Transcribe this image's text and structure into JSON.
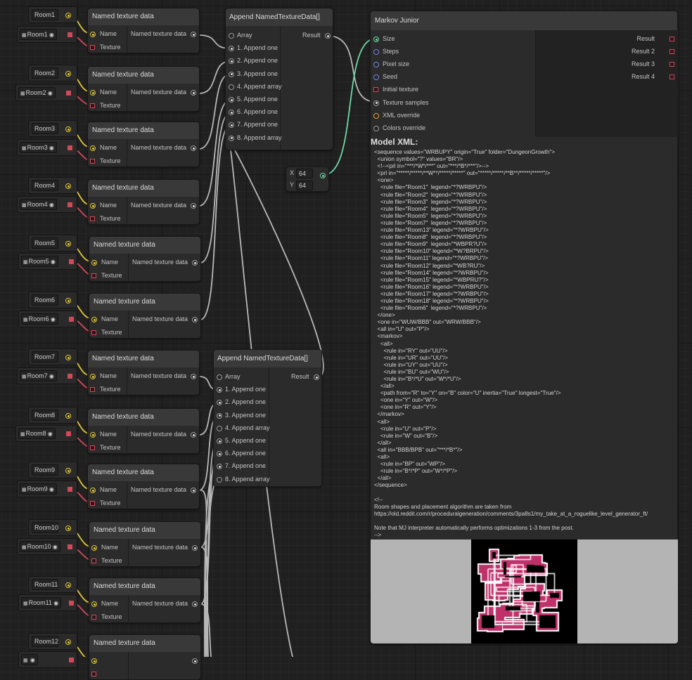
{
  "room_nodes": [
    {
      "name": "Room1",
      "texture": "Room1",
      "node_title": "Named texture data",
      "in_name": "Name",
      "in_texture": "Texture",
      "out_label": "Named texture data"
    },
    {
      "name": "Room2",
      "texture": "Room2",
      "node_title": "Named texture data",
      "in_name": "Name",
      "in_texture": "Texture",
      "out_label": "Named texture data"
    },
    {
      "name": "Room3",
      "texture": "Room3",
      "node_title": "Named texture data",
      "in_name": "Name",
      "in_texture": "Texture",
      "out_label": "Named texture data"
    },
    {
      "name": "Room4",
      "texture": "Room4",
      "node_title": "Named texture data",
      "in_name": "Name",
      "in_texture": "Texture",
      "out_label": "Named texture data"
    },
    {
      "name": "Room5",
      "texture": "Room5",
      "node_title": "Named texture data",
      "in_name": "Name",
      "in_texture": "Texture",
      "out_label": "Named texture data"
    },
    {
      "name": "Room6",
      "texture": "Room6",
      "node_title": "Named texture data",
      "in_name": "Name",
      "in_texture": "Texture",
      "out_label": "Named texture data"
    },
    {
      "name": "Room7",
      "texture": "Room7",
      "node_title": "Named texture data",
      "in_name": "Name",
      "in_texture": "Texture",
      "out_label": "Named texture data"
    },
    {
      "name": "Room8",
      "texture": "Room8",
      "node_title": "Named texture data",
      "in_name": "Name",
      "in_texture": "Texture",
      "out_label": "Named texture data"
    },
    {
      "name": "Room9",
      "texture": "Room9",
      "node_title": "Named texture data",
      "in_name": "Name",
      "in_texture": "Texture",
      "out_label": "Named texture data"
    },
    {
      "name": "Room10",
      "texture": "Room10",
      "node_title": "Named texture data",
      "in_name": "Name",
      "in_texture": "Texture",
      "out_label": "Named texture data"
    },
    {
      "name": "Room11",
      "texture": "Room11",
      "node_title": "Named texture data",
      "in_name": "Name",
      "in_texture": "Texture",
      "out_label": "Named texture data"
    },
    {
      "name": "Room12",
      "texture": "",
      "node_title": "Named texture data",
      "in_name": "",
      "in_texture": "",
      "out_label": ""
    }
  ],
  "append_nodes": [
    {
      "title": "Append NamedTextureData[]",
      "array": "Array",
      "result": "Result",
      "items": [
        "1. Append one",
        "2. Append one",
        "3. Append one",
        "4. Append array",
        "5. Append one",
        "6. Append one",
        "7. Append one",
        "8. Append array"
      ]
    },
    {
      "title": "Append NamedTextureData[]",
      "array": "Array",
      "result": "Result",
      "items": [
        "1. Append one",
        "2. Append one",
        "3. Append one",
        "4. Append array",
        "5. Append one",
        "6. Append one",
        "7. Append one",
        "8. Append array"
      ]
    }
  ],
  "vector": {
    "x_label": "X",
    "x_value": "64",
    "y_label": "Y",
    "y_value": "64"
  },
  "markov": {
    "title": "Markov Junior",
    "inputs": [
      "Size",
      "Steps",
      "Pixel size",
      "Seed",
      "Initial texture",
      "Texture samples",
      "XML override",
      "Colors override"
    ],
    "outputs": [
      "Result",
      "Result 2",
      "Result 3",
      "Result 4"
    ],
    "xml_heading": "Model XML:",
    "xml_text": "<sequence values=\"WRBUPY\" origin=\"True\" folder=\"DungeonGrowth\">\n  <union symbol=\"?\" values=\"BR\"/>\n  <!--<prl in=\"***/*W*/***\" out=\"***/*B*/***\"/>-->\n  <prl in=\"*****/*****/**W**/*****/*****\" out=\"*****/*****/**B**/*****/*****\"/>\n  <one>\n    <rule file=\"Room1\"  legend=\"*?WRBPU\"/>\n    <rule file=\"Room2\"  legend=\"*?WRBPU\"/>\n    <rule file=\"Room3\"  legend=\"*?WRBPU\"/>\n    <rule file=\"Room4\"  legend=\"*?WRBPU\"/>\n    <rule file=\"Room5\"  legend=\"*?WRBPU\"/>\n    <rule file=\"Room7\"  legend=\"*?WRBPU\"/>\n    <rule file=\"Room13\" legend=\"*?WRBPU\"/>\n    <rule file=\"Room8\"  legend=\"*?WRBPU\"/>\n    <rule file=\"Room9\"  legend=\"*WBPR?U\"/>\n    <rule file=\"Room10\" legend=\"*W?BRPU\"/>\n    <rule file=\"Room11\" legend=\"*?WRBPU\"/>\n    <rule file=\"Room12\" legend=\"*WB?RU\"/>\n    <rule file=\"Room14\" legend=\"*?WRBPU\"/>\n    <rule file=\"Room15\" legend=\"*WBPRU?\"/>\n    <rule file=\"Room16\" legend=\"*?WRBPU\"/>\n    <rule file=\"Room17\" legend=\"*?WRBPU\"/>\n    <rule file=\"Room18\" legend=\"*?WRBPU\"/>\n    <rule file=\"Room6\"  legend=\"*?WRBPU\"/>\n  </one>\n  <one in=\"WUW/BBB\" out=\"WRW/BBB\"/>\n  <all in=\"U\" out=\"P\"/>\n  <markov>\n    <all>\n      <rule in=\"RY\" out=\"UU\"/>\n      <rule in=\"UR\" out=\"UU\"/>\n      <rule in=\"UY\" out=\"UU\"/>\n      <rule in=\"BU\" out=\"WU\"/>\n      <rule in=\"B*/*U\" out=\"W*/*U\"/>\n    </all>\n    <path from=\"R\" to=\"Y\" on=\"B\" color=\"U\" inertia=\"True\" longest=\"True\"/>\n    <one in=\"Y\" out=\"W\"/>\n    <one in=\"R\" out=\"Y\"/>\n  </markov>\n  <all>\n    <rule in=\"U\" out=\"P\"/>\n    <rule in=\"W\" out=\"B\"/>\n  </all>\n  <all in=\"BBB/BPB\" out=\"***/*B*\"/>\n  <all>\n    <rule in=\"BP\" out=\"WP\"/>\n    <rule in=\"B*/*P\" out=\"W*/*P\"/>\n  </all>\n</sequence>\n\n<!--\nRoom shapes and placement algorithm are taken from\nhttps://old.reddit.com/r/proceduralgeneration/comments/3pa8s1/my_take_at_a_roguelike_level_generator_ft/\n\nNote that MJ interpreter automatically performs optimizations 1-3 from the post.\n-->"
  },
  "colors": {
    "background": "#202020",
    "node": "#2b2b2b",
    "header": "#393939",
    "wire": "#b8b8b8",
    "wire_teal": "#6fd9a8",
    "name_pin": "#e2c83a",
    "texture_pin": "#d04a5a",
    "dungeon_wall": "#c0306a",
    "dungeon_floor": "#000000",
    "preview_bg": "#b4b4b4"
  }
}
